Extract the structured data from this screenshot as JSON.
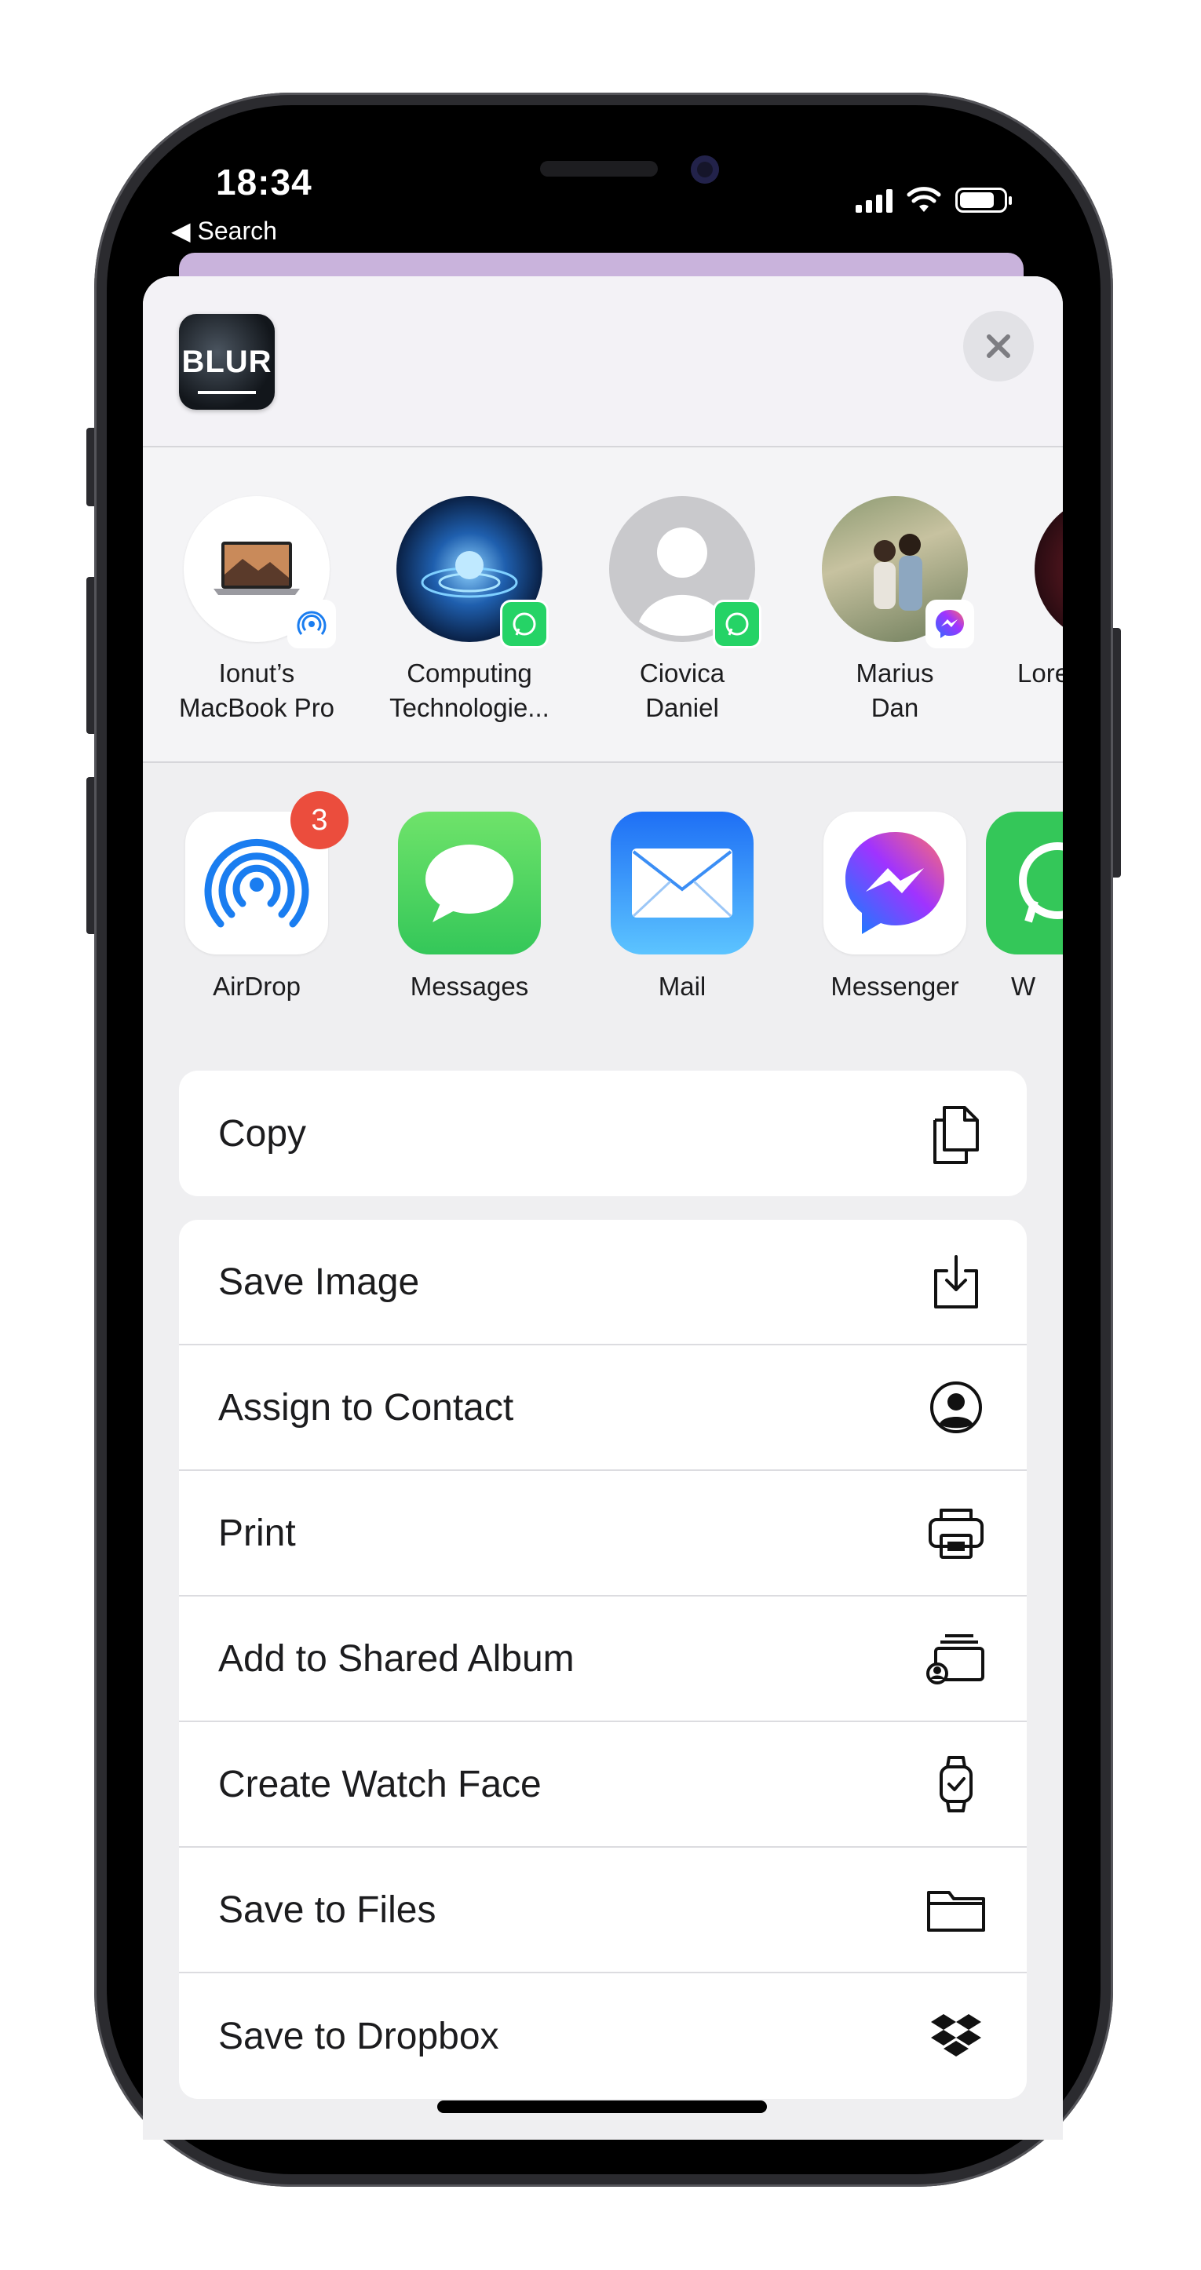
{
  "status_bar": {
    "time": "18:34",
    "back_label": "◀ Search"
  },
  "share_sheet": {
    "thumbnail_text": "BLUR",
    "people": [
      {
        "name_line1": "Ionut’s",
        "name_line2": "MacBook Pro"
      },
      {
        "name_line1": "Computing",
        "name_line2": "Technologie..."
      },
      {
        "name_line1": "Ciovica",
        "name_line2": "Daniel"
      },
      {
        "name_line1": "Marius",
        "name_line2": "Dan"
      },
      {
        "name_line1": "Lore",
        "name_line2": ""
      }
    ],
    "apps": [
      {
        "label": "AirDrop",
        "badge": "3"
      },
      {
        "label": "Messages"
      },
      {
        "label": "Mail"
      },
      {
        "label": "Messenger"
      },
      {
        "label": "W"
      }
    ],
    "copy_action": "Copy",
    "actions": [
      "Save Image",
      "Assign to Contact",
      "Print",
      "Add to Shared Album",
      "Create Watch Face",
      "Save to Files",
      "Save to Dropbox"
    ]
  },
  "colors": {
    "whatsapp": "#25d366",
    "messages": "#34c759",
    "mail": "#1e8bf5",
    "airdrop": "#1a7df0",
    "badge": "#eb4d3d"
  }
}
